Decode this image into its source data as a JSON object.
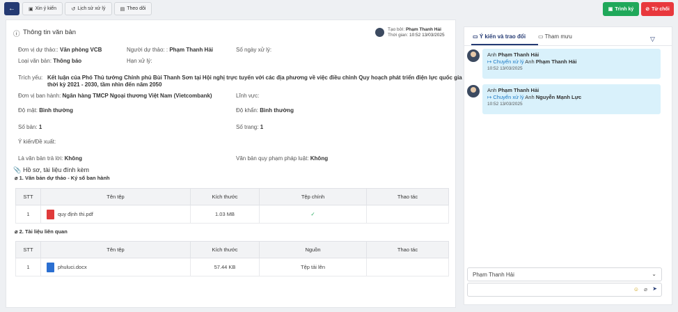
{
  "toolbar": {
    "xin_y_kien": "Xin ý kiến",
    "lich_su": "Lịch sử xử lý",
    "theo_doi": "Theo dõi",
    "trinh_ky": "Trình ký",
    "tu_choi": "Từ chối"
  },
  "doc": {
    "section_title": "Thông tin văn bản",
    "created_by_label": "Tạo bởi:",
    "created_by": "Phạm Thanh Hải",
    "time_label": "Thời gian:",
    "time": "10:52 13/03/2025",
    "don_vi_du_thao_label": "Đơn vị dự thảo::",
    "don_vi_du_thao": "Văn phòng VCB",
    "nguoi_du_thao_label": "Người dự thảo: :",
    "nguoi_du_thao": "Phạm Thanh Hải",
    "so_ngay_label": "Số ngày xử lý:",
    "loai_label": "Loại văn bản:",
    "loai": "Thông báo",
    "han_label": "Hạn xử lý:",
    "trich_yeu_label": "Trích yếu:",
    "trich_yeu_1": "Kết luận của Phó Thủ tướng Chính phủ Bùi Thanh Sơn tại Hội nghị trực tuyến với các địa phương về việc điều chỉnh Quy hoạch phát triển điện lực quốc gia",
    "trich_yeu_2": "thời kỳ 2021 - 2030, tầm nhìn đến năm 2050",
    "don_vi_bh_label": "Đơn vị ban hành:",
    "don_vi_bh": "Ngân hàng TMCP Ngoại thương Việt Nam (Vietcombank)",
    "linh_vuc_label": "Lĩnh vực:",
    "do_mat_label": "Độ mật:",
    "do_mat": "Bình thường",
    "do_khan_label": "Độ khẩn:",
    "do_khan": "Bình thường",
    "so_ban_label": "Số bản:",
    "so_ban": "1",
    "so_trang_label": "Số trang:",
    "so_trang": "1",
    "y_kien_label": "Ý kiến/Đề xuất:",
    "tra_loi_label": "Là văn bản trả lời:",
    "tra_loi": "Không",
    "qppl_label": "Văn bản quy phạm pháp luật:",
    "qppl": "Không"
  },
  "attach": {
    "title": "Hồ sơ, tài liệu đính kèm",
    "sub1": "1. Văn bản dự thảo - Ký số ban hành",
    "sub2": "2. Tài liệu liên quan",
    "t1_headers": [
      "STT",
      "Tên tệp",
      "Kích thước",
      "Tệp chính",
      "Thao tác"
    ],
    "t1_rows": [
      {
        "stt": "1",
        "name": "quy định thi.pdf",
        "size": "1.03 MB",
        "main": "✓"
      }
    ],
    "t2_headers": [
      "STT",
      "Tên tệp",
      "Kích thước",
      "Nguồn",
      "Thao tác"
    ],
    "t2_rows": [
      {
        "stt": "1",
        "name": "phuluci.docx",
        "size": "57.44 KB",
        "source": "Tệp tải lên"
      }
    ]
  },
  "side": {
    "tab1": "Ý kiến và trao đổi",
    "tab2": "Tham mưu",
    "messages": [
      {
        "prefix": "Anh",
        "name": "Phạm Thanh Hải",
        "action": "Chuyển xử lý",
        "to_prefix": "Anh",
        "to": "Phạm Thanh Hải",
        "time": "10:52 13/03/2025"
      },
      {
        "prefix": "Anh",
        "name": "Phạm Thanh Hải",
        "action": "Chuyển xử lý",
        "to_prefix": "Anh",
        "to": "Nguyễn Mạnh Lực",
        "time": "10:52 13/03/2025"
      }
    ],
    "select_value": "Phạm Thanh Hải",
    "comment_placeholder": ""
  },
  "colors": {
    "primary": "#243a73",
    "success": "#1fa85a",
    "danger": "#e8383d",
    "message_bg": "#d9f1fb",
    "link": "#1b79c4"
  }
}
